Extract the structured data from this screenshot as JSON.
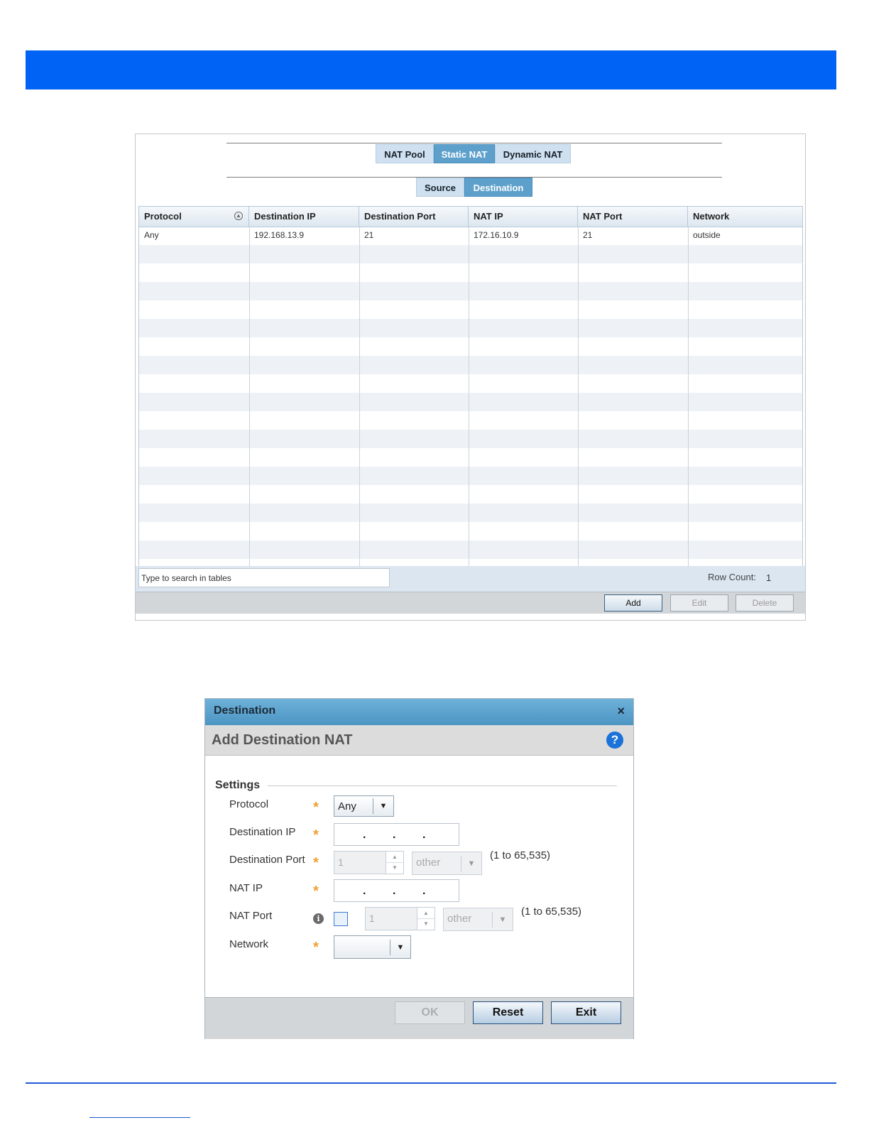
{
  "figure1": {
    "tabs": [
      {
        "label": "NAT Pool",
        "active": false
      },
      {
        "label": "Static NAT",
        "active": true
      },
      {
        "label": "Dynamic NAT",
        "active": false
      }
    ],
    "subtabs": [
      {
        "label": "Source",
        "active": false
      },
      {
        "label": "Destination",
        "active": true
      }
    ],
    "table": {
      "columns": [
        "Protocol",
        "Destination IP",
        "Destination Port",
        "NAT IP",
        "NAT Port",
        "Network"
      ],
      "rows": [
        [
          "Any",
          "192.168.13.9",
          "21",
          "172.16.10.9",
          "21",
          "outside"
        ]
      ]
    },
    "search_placeholder": "Type to search in tables",
    "row_count_label": "Row Count:",
    "row_count_value": "1",
    "buttons": {
      "add": "Add",
      "edit": "Edit",
      "delete": "Delete"
    }
  },
  "figure2": {
    "window_title": "Destination",
    "close_symbol": "×",
    "heading": "Add Destination NAT",
    "help_symbol": "?",
    "section": "Settings",
    "fields": {
      "protocol": {
        "label": "Protocol",
        "value": "Any"
      },
      "destination_ip": {
        "label": "Destination IP"
      },
      "destination_port": {
        "label": "Destination Port",
        "value": "1",
        "type": "other",
        "range": "(1 to 65,535)"
      },
      "nat_ip": {
        "label": "NAT IP"
      },
      "nat_port": {
        "label": "NAT Port",
        "value": "1",
        "type": "other",
        "range": "(1 to 65,535)"
      },
      "network": {
        "label": "Network",
        "value": ""
      }
    },
    "required_mark": "*",
    "info_symbol": "i",
    "buttons": {
      "ok": "OK",
      "reset": "Reset",
      "exit": "Exit"
    }
  },
  "colors": {
    "header_band": "#0063f5",
    "active_tab": "#5ea0cc",
    "dialog_title": "#4c95c3",
    "required_star": "#f0a030"
  }
}
